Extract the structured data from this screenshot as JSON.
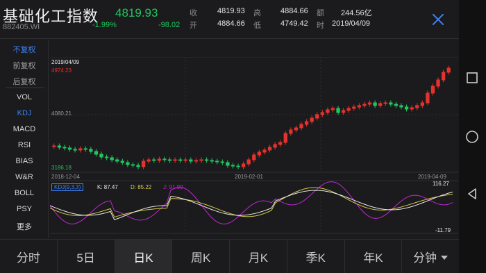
{
  "header": {
    "title": "基础化工指数",
    "code": "882405.WI",
    "price": "4819.93",
    "change_pct": "-1.99%",
    "change": "-98.02",
    "quotes": [
      {
        "label": "收",
        "value": "4819.93"
      },
      {
        "label": "高",
        "value": "4884.66"
      },
      {
        "label": "额",
        "value": "244.56亿"
      },
      {
        "label": "开",
        "value": "4884.66"
      },
      {
        "label": "低",
        "value": "4749.42"
      },
      {
        "label": "时",
        "value": "2019/04/09"
      }
    ]
  },
  "menu": {
    "items": [
      "不复权",
      "前复权",
      "后复权",
      "VOL",
      "KDJ",
      "MACD",
      "RSI",
      "BIAS",
      "W&R",
      "BOLL",
      "PSY",
      "更多"
    ]
  },
  "chart_labels": {
    "date_top": "2019/04/09",
    "y_high": "4974.23",
    "y_mid": "4080.21",
    "y_low": "3186.18",
    "x_start": "2018-12-04",
    "x_mid": "2019-02-01",
    "x_end": "2019-04-09",
    "ind_name": "KDJ(9,3,3)",
    "k_label": "K: 87.47",
    "d_label": "D: 85.22",
    "j_label": "J: 91.99",
    "ind_max": "116.27",
    "ind_min": "-11.79"
  },
  "tabs": [
    "分时",
    "5日",
    "日K",
    "周K",
    "月K",
    "季K",
    "年K",
    "分钟"
  ],
  "colors": {
    "up": "#e5322d",
    "down": "#22c55e",
    "accent": "#3b82f6",
    "k_line": "#e8e8e8",
    "d_line": "#d6c94a",
    "j_line": "#c026d3"
  },
  "icons": {
    "close": "close-icon",
    "nav_square": "recent-apps-icon",
    "nav_circle": "home-icon",
    "nav_back": "back-icon"
  }
}
